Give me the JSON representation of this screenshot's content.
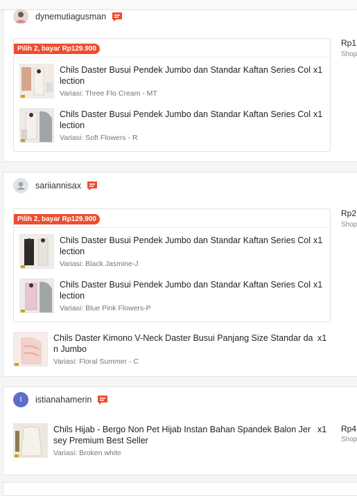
{
  "orders": [
    {
      "username": "dynemutiagusman",
      "bundle_tag": "Pilih 2, bayar Rp129.900",
      "price": "Rp1",
      "shop": "Shop",
      "items": [
        {
          "name": "Chils Daster Busui Pendek Jumbo dan Standar Kaftan Series Collection",
          "variant": "Variasi: Three Flo Cream - MT",
          "qty": "x1"
        },
        {
          "name": "Chils Daster Busui Pendek Jumbo dan Standar Kaftan Series Collection",
          "variant": "Variasi: Soft Flowers - R",
          "qty": "x1"
        }
      ]
    },
    {
      "username": "sariiannisax",
      "bundle_tag": "Pilih 2, bayar Rp129.900",
      "price": "Rp2",
      "shop": "Shop",
      "items": [
        {
          "name": "Chils Daster Busui Pendek Jumbo dan Standar Kaftan Series Collection",
          "variant": "Variasi: Black Jasmine-J",
          "qty": "x1"
        },
        {
          "name": "Chils Daster Busui Pendek Jumbo dan Standar Kaftan Series Collection",
          "variant": "Variasi: Blue Pink Flowers-P",
          "qty": "x1"
        }
      ],
      "extra_item": {
        "name": "Chils Daster Kimono V-Neck Daster Busui Panjang Size Standar dan Jumbo",
        "variant": "Variasi: Floral Summer - C",
        "qty": "x1"
      }
    },
    {
      "username": "istianahamerin",
      "avatar_letter": "I",
      "price": "Rp4",
      "shop": "Shop",
      "items": [
        {
          "name": "Chils Hijab - Bergo Non Pet Hijab Instan Bahan Spandek Balon Jersey Premium Best Seller",
          "variant": "Variasi: Broken white",
          "qty": "x1"
        }
      ]
    }
  ],
  "colors": {
    "accent": "#ee4d2d",
    "chat_icon": "#ee4d2d",
    "avatar_initial_bg": "#5b6ec9",
    "avatar_default_bg": "#dfe3e6"
  }
}
